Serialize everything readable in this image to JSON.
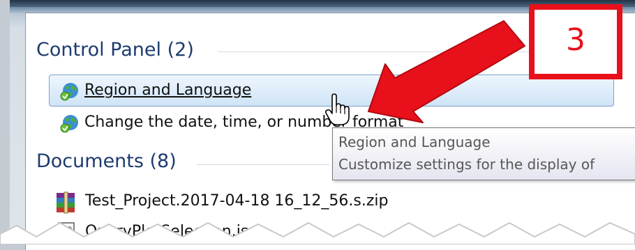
{
  "sections": {
    "control_panel": {
      "header": "Control Panel (2)"
    },
    "documents": {
      "header": "Documents (8)"
    }
  },
  "control_panel_results": [
    {
      "label": "Region and Language",
      "icon": "globe-icon",
      "hovered": true
    },
    {
      "label": "Change the date, time, or number format",
      "icon": "globe-icon",
      "hovered": false
    }
  ],
  "document_results": [
    {
      "label": "Test_Project.2017-04-18 16_12_56.s.zip",
      "icon": "winrar-archive-icon"
    },
    {
      "label": "QueryPlotSelection.js",
      "icon": "js-file-icon"
    }
  ],
  "tooltip": {
    "title": "Region and Language",
    "description": "Customize settings for the display of"
  },
  "annotation": {
    "step": "3",
    "color": "#e8101a"
  },
  "colors": {
    "header_text": "#1e3b6f",
    "hover_border": "#7da2ce",
    "accent_red": "#e8101a"
  }
}
